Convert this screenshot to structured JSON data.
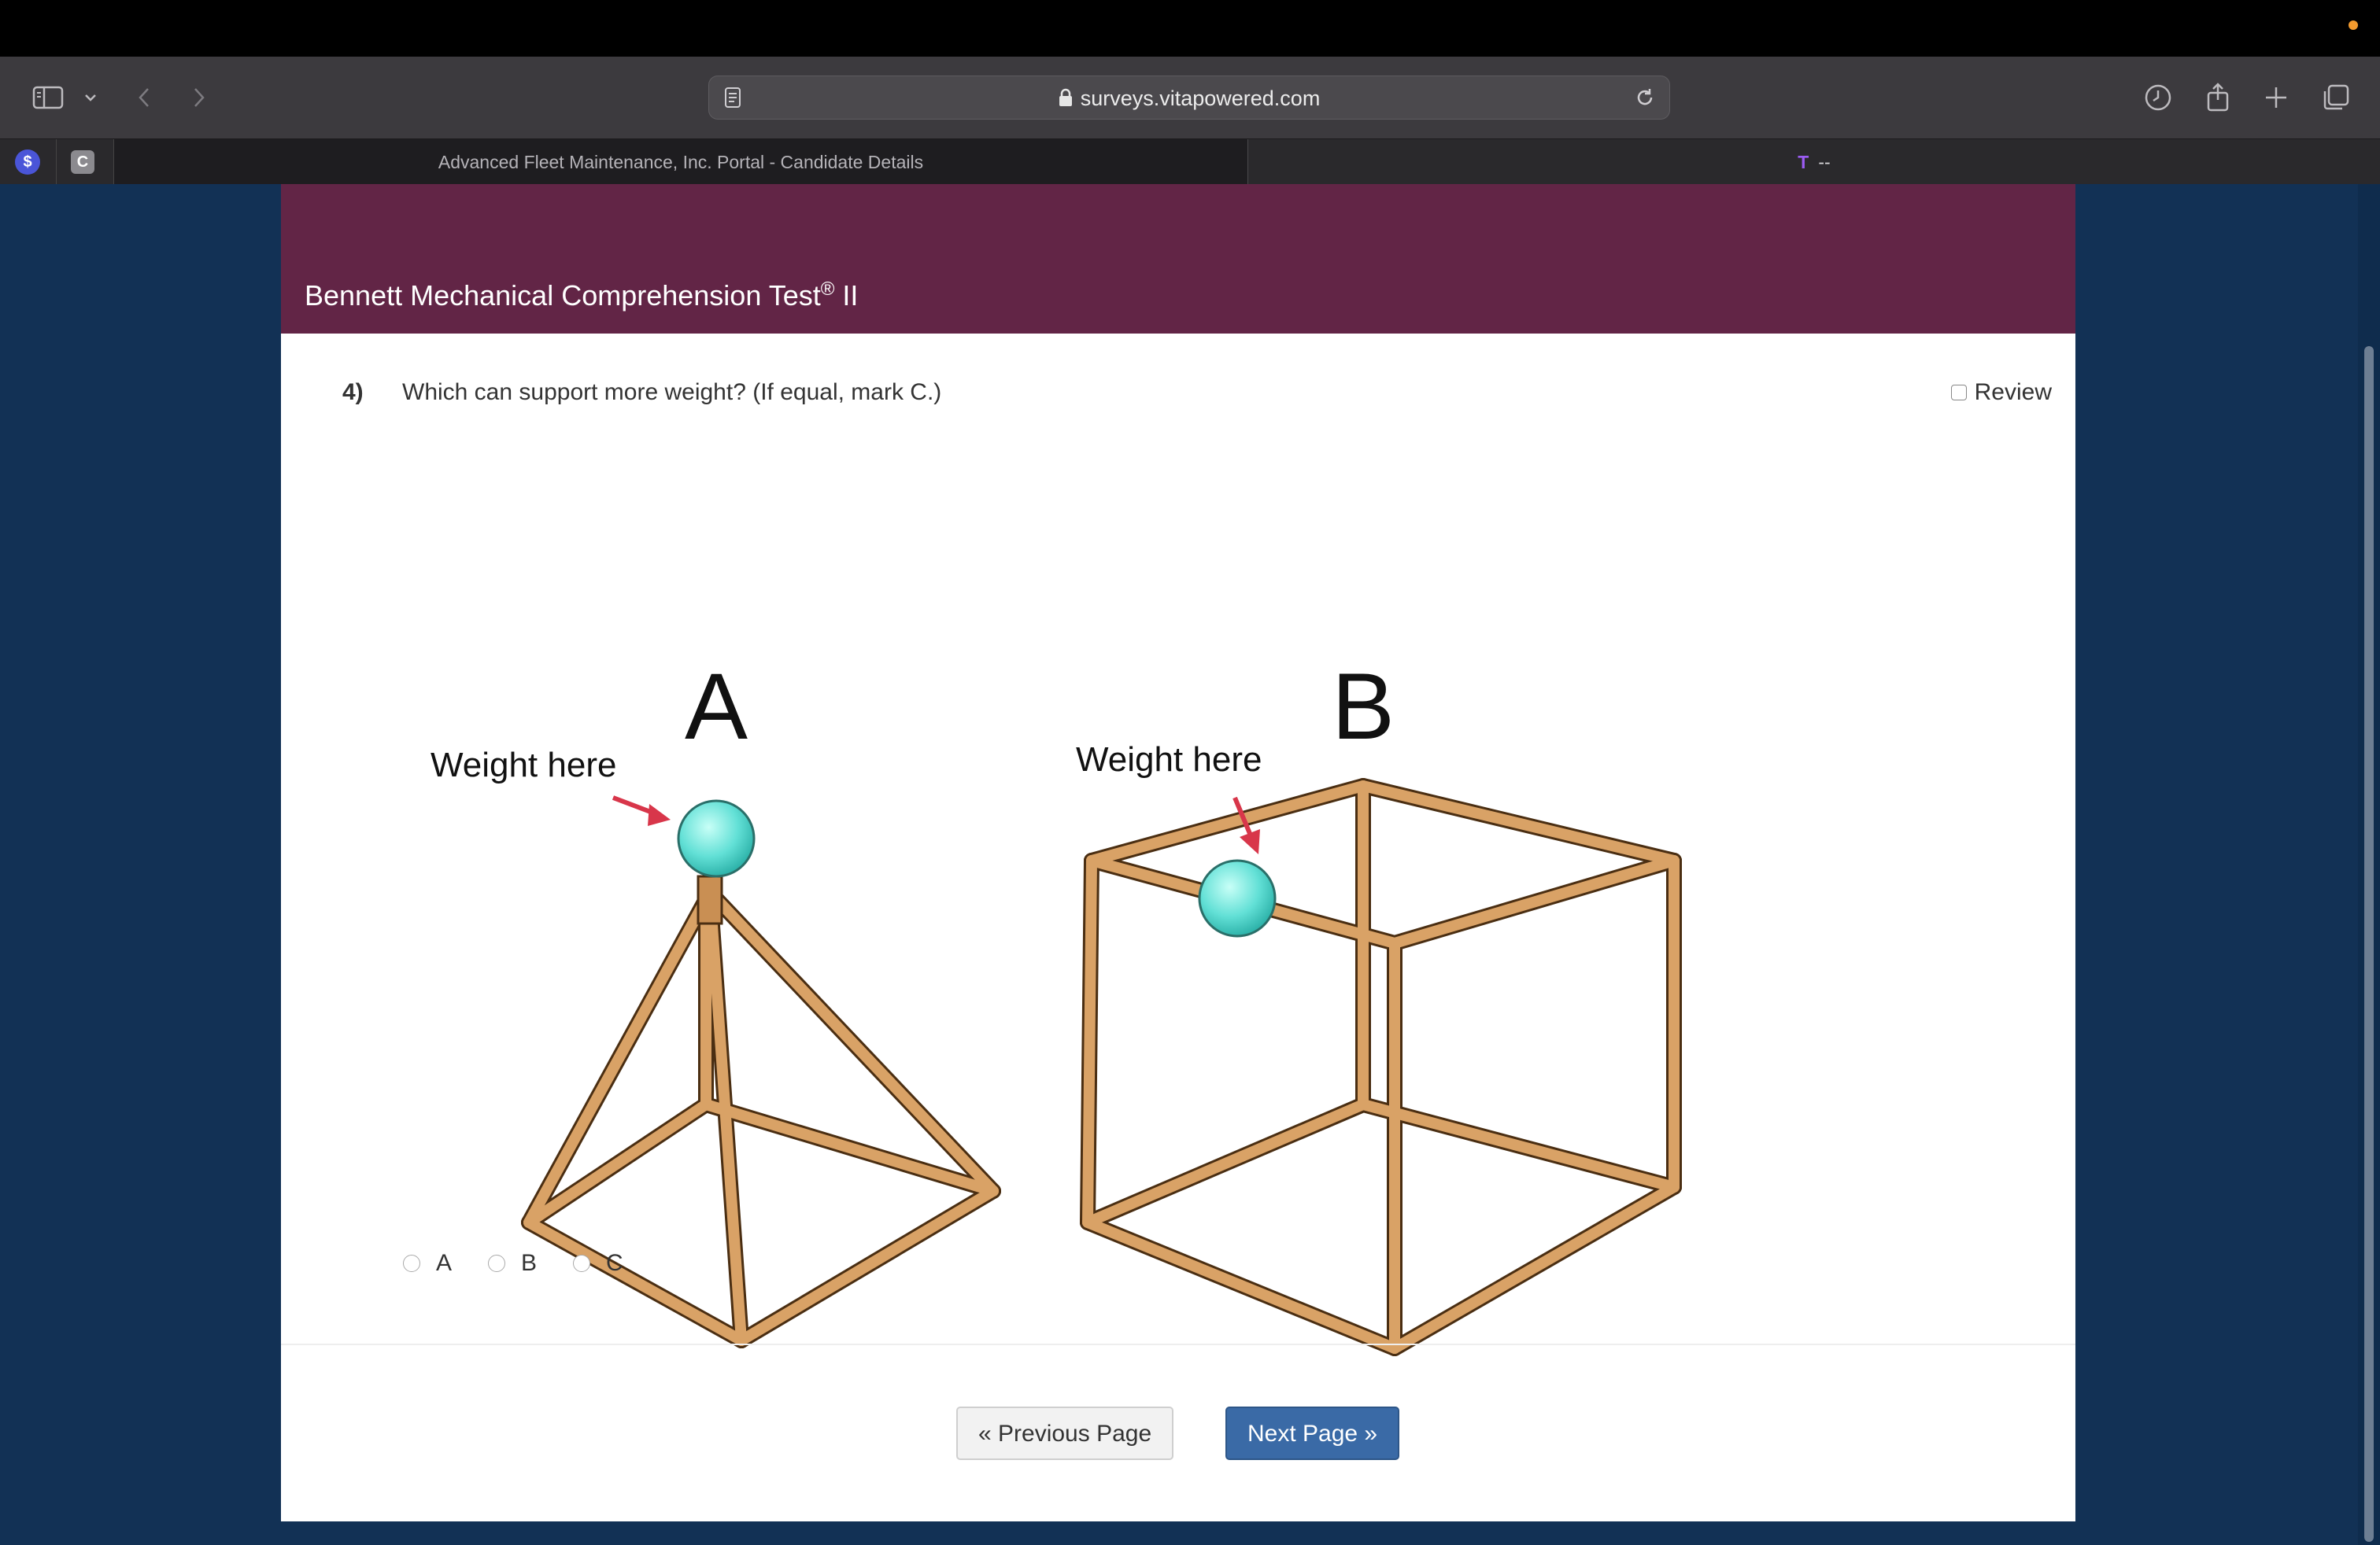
{
  "browser": {
    "url": "surveys.vitapowered.com",
    "tabs": [
      {
        "label": "Advanced Fleet Maintenance, Inc. Portal - Candidate Details",
        "active": true
      },
      {
        "label": "--",
        "icon": "T",
        "active": false
      }
    ],
    "pinned": [
      {
        "glyph": "$",
        "color": "#4a55d8"
      },
      {
        "glyph": "C",
        "color": "#8b8a8f"
      }
    ]
  },
  "page": {
    "banner_title": "Bennett Mechanical Comprehension Test",
    "banner_title_reg": "®",
    "banner_title_suffix": " II",
    "question": {
      "number": "4)",
      "text": "Which can support more weight? (If equal, mark C.)",
      "review_label": "Review"
    },
    "figure": {
      "label_a": "A",
      "label_b": "B",
      "weight_label_a": "Weight here",
      "weight_label_b": "Weight here"
    },
    "options": [
      {
        "label": "A"
      },
      {
        "label": "B"
      },
      {
        "label": "C"
      }
    ],
    "prev_button": "« Previous Page",
    "next_button": "Next Page »"
  },
  "colors": {
    "banner": "#622546",
    "page_bg": "#123155",
    "next_button": "#3a6aa6",
    "wood": "#d9a266",
    "ball": "#62e0d6",
    "arrow": "#d8364a"
  }
}
